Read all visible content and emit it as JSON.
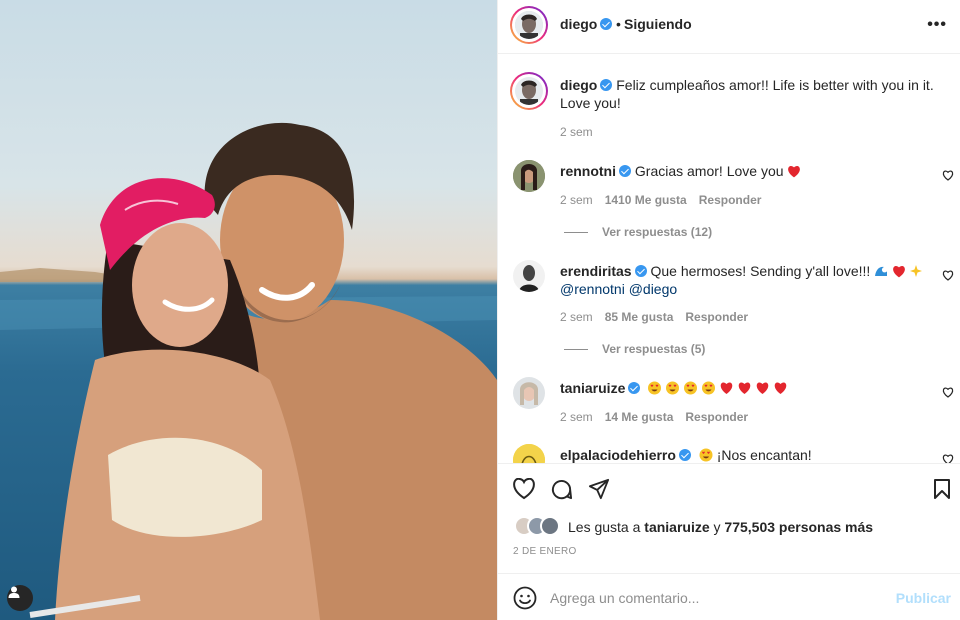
{
  "post": {
    "author": "diego",
    "follow_status": "Siguiendo",
    "dot": "•",
    "more_label": "•••",
    "caption": "Feliz cumpleaños amor!! Life is better with you in it. Love you!",
    "caption_time": "2 sem"
  },
  "comments": [
    {
      "user": "rennotni",
      "text": "Gracias amor! Love you",
      "emoji": [
        "red-heart"
      ],
      "time": "2 sem",
      "likes": "1410 Me gusta",
      "reply": "Responder",
      "view_replies": "Ver respuestas (12)"
    },
    {
      "user": "erendiritas",
      "text": "Que hermoses! Sending y'all love!!!",
      "emoji": [
        "wave",
        "red-heart",
        "sparkles"
      ],
      "mentions": "@rennotni @diego",
      "time": "2 sem",
      "likes": "85 Me gusta",
      "reply": "Responder",
      "view_replies": "Ver respuestas (5)"
    },
    {
      "user": "taniaruize",
      "text": "",
      "emoji": [
        "heart-eyes",
        "heart-eyes",
        "heart-eyes",
        "heart-eyes",
        "red-heart",
        "red-heart",
        "red-heart",
        "red-heart"
      ],
      "time": "2 sem",
      "likes": "14 Me gusta",
      "reply": "Responder"
    },
    {
      "user": "elpalaciodehierro",
      "text": "¡Nos encantan!",
      "emoji": [
        "heart-eyes"
      ]
    }
  ],
  "likes": {
    "prefix": "Les gusta a",
    "user": "taniaruize",
    "joiner": "y",
    "count": "775,503 personas más"
  },
  "date": "2 DE ENERO",
  "composer": {
    "placeholder": "Agrega un comentario...",
    "publish": "Publicar"
  },
  "colors": {
    "verified": "#3897f0",
    "publish_disabled": "#b2dffc",
    "meta_gray": "#8e8e8e"
  }
}
